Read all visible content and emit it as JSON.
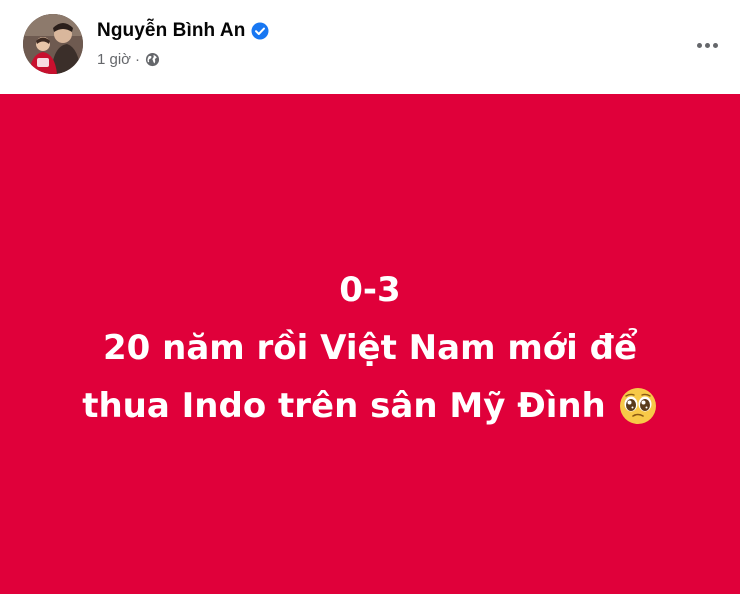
{
  "author": {
    "name": "Nguyễn Bình An",
    "verified_icon": "verified-badge-icon"
  },
  "meta": {
    "time": "1 giờ",
    "separator": "·",
    "privacy_icon": "globe-icon"
  },
  "menu": {
    "icon": "more-options-icon"
  },
  "post": {
    "background_color": "#e0003a",
    "text_color": "#ffffff",
    "lines": [
      "0-3",
      "20 năm rồi Việt Nam mới để",
      "thua Indo trên sân Mỹ Đình"
    ],
    "emoji": "pleading-face-icon"
  },
  "colors": {
    "verified_blue": "#1877f2",
    "meta_gray": "#65676b"
  }
}
